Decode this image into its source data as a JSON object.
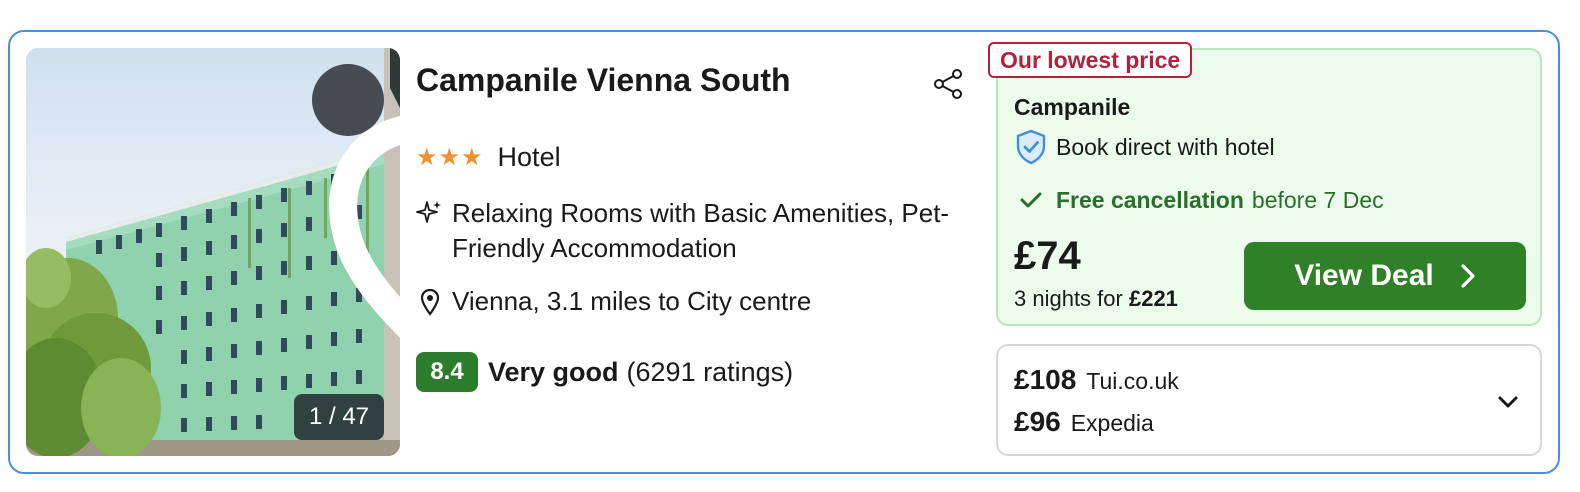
{
  "hotel": {
    "name": "Campanile Vienna South",
    "stars": "★★★",
    "type": "Hotel",
    "amenities": "Relaxing Rooms with Basic Amenities, Pet-Friendly Accommodation",
    "location": "Vienna, 3.1 miles to City centre",
    "rating_score": "8.4",
    "rating_word": "Very good",
    "rating_count": "(6291 ratings)",
    "photo_counter": "1 / 47"
  },
  "deal": {
    "tag": "Our lowest price",
    "provider": "Campanile",
    "direct_label": "Book direct with hotel",
    "cancellation_bold": "Free cancellation",
    "cancellation_date": "before 7 Dec",
    "price": "£74",
    "nights_prefix": "3 nights for",
    "nights_total": "£221",
    "button_label": "View Deal"
  },
  "other_offers": [
    {
      "price": "£108",
      "site": "Tui.co.uk"
    },
    {
      "price": "£96",
      "site": "Expedia"
    }
  ],
  "icons": {
    "favorite": "heart-icon",
    "share": "share-icon",
    "amenities": "sparkle-icon",
    "location": "map-pin-icon",
    "direct": "shield-check-icon",
    "cancellation": "checkmark-icon",
    "view_deal": "chevron-right-icon",
    "expand": "chevron-down-icon"
  },
  "colors": {
    "card_border": "#4a8fd8",
    "star": "#f0912f",
    "rating_badge": "#2b7d2b",
    "deal_background": "#ecfbec",
    "lowest_tag": "#b0233a",
    "cancellation_text": "#2b6e2b",
    "view_deal_button": "#2f8127"
  }
}
